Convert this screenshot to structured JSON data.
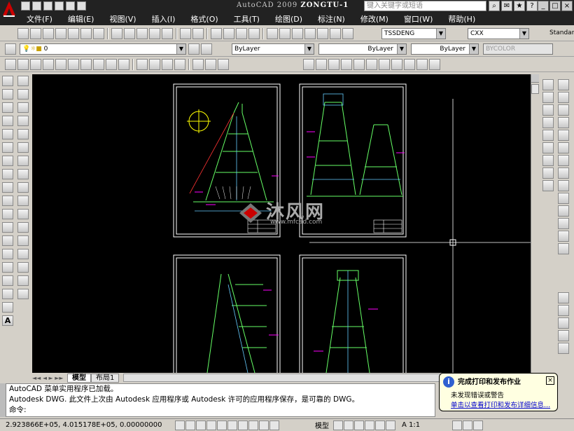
{
  "app": {
    "title_prefix": "AutoCAD 2009",
    "title_file": "ZONGTU-1",
    "search_placeholder": "键入关键字或短语"
  },
  "menu": [
    "文件(F)",
    "编辑(E)",
    "视图(V)",
    "插入(I)",
    "格式(O)",
    "工具(T)",
    "绘图(D)",
    "标注(N)",
    "修改(M)",
    "窗口(W)",
    "帮助(H)"
  ],
  "toolbar": {
    "textstyle": "TSSDENG",
    "dimstyle": "CXX",
    "tablestyle": "Standar",
    "layer": "0",
    "color": "ByLayer",
    "linetype": "ByLayer",
    "lineweight": "ByLayer",
    "plotstyle": "BYCOLOR"
  },
  "layout_tabs": [
    "模型",
    "布局1"
  ],
  "command": {
    "line1": "AutoCAD 菜单实用程序已加载。",
    "line2": "Autodesk DWG.   此文件上次由 Autodesk 应用程序或 Autodesk 许可的应用程序保存，是可靠的 DWG。",
    "prompt": "命令:"
  },
  "status": {
    "coords": "2.923866E+05, 4.015178E+05, 0.00000000",
    "model": "模型",
    "scale": "A 1:1"
  },
  "notification": {
    "title": "完成打印和发布作业",
    "line": "未发现错误或警告",
    "link": "单击以查看打印和发布详细信息..."
  },
  "watermark": {
    "brand": "沐风网",
    "url": "www.mfcad.com"
  }
}
